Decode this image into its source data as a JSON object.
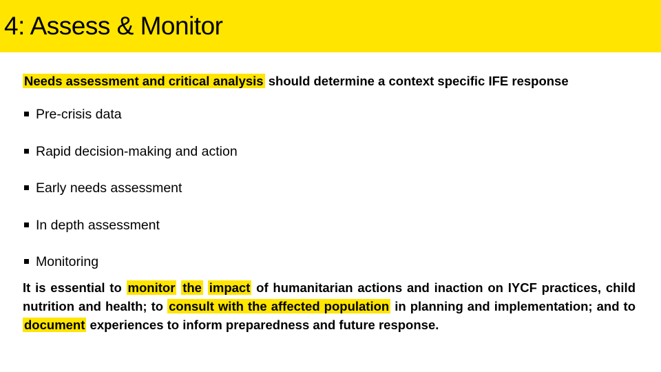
{
  "slide": {
    "title": "4: Assess & Monitor",
    "accent_color": "#FFE500",
    "lead": {
      "highlighted": "Needs assessment and critical analysis",
      "rest": " should determine a context specific IFE response"
    },
    "bullets": [
      "Pre-crisis data",
      "Rapid decision-making  and action",
      "Early needs assessment",
      "In depth assessment",
      "Monitoring"
    ],
    "paragraph": {
      "t1": "It is essential to ",
      "h1": "monitor",
      "t2": " ",
      "h2": "the",
      "t3": " ",
      "h3": "impact",
      "t4": " of humanitarian actions and inaction on IYCF practices, child nutrition and health; to ",
      "h4": "consult with the affected population",
      "t5": " in planning and implementation; and to ",
      "h5": "document",
      "t6": " experiences to inform preparedness and future response."
    }
  }
}
